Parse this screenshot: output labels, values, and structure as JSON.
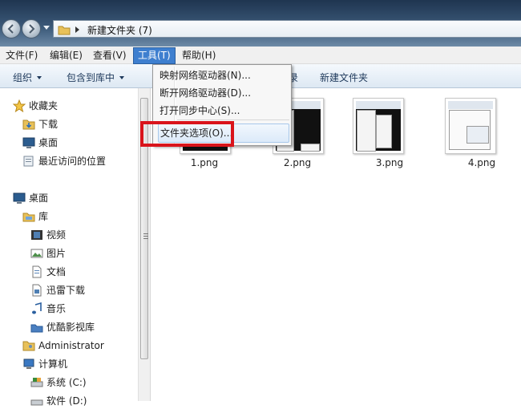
{
  "address_bar": {
    "path_text": "新建文件夹 (7)"
  },
  "menu_bar": {
    "file": "文件(F)",
    "edit": "编辑(E)",
    "view": "查看(V)",
    "tools": "工具(T)",
    "help": "帮助(H)"
  },
  "command_bar": {
    "organize": "组织",
    "include_in_library": "包含到库中",
    "share_tail": "录",
    "new_folder": "新建文件夹"
  },
  "tools_menu": {
    "items": [
      "映射网络驱动器(N)...",
      "断开网络驱动器(D)...",
      "打开同步中心(S)..."
    ],
    "folder_options": "文件夹选项(O)..."
  },
  "nav_pane": {
    "favorites": "收藏夹",
    "downloads": "下载",
    "desktop_fav": "桌面",
    "recent_places": "最近访问的位置",
    "desktop": "桌面",
    "libraries": "库",
    "videos": "视频",
    "pictures": "图片",
    "documents": "文档",
    "xunlei": "迅雷下载",
    "music": "音乐",
    "youku": "优酷影视库",
    "administrator": "Administrator",
    "computer": "计算机",
    "system_c": "系统 (C:)",
    "software_d": "软件 (D:)"
  },
  "files": [
    "1.png",
    "2.png",
    "3.png",
    "4.png"
  ],
  "colors": {
    "menu_highlight": "#3e7fcf",
    "annotation_box": "#d9141b"
  }
}
